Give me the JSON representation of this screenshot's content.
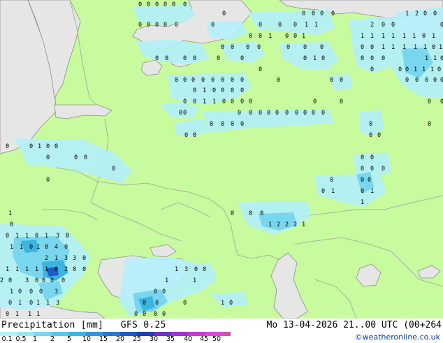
{
  "product_label": "Precipitation [mm]",
  "model_label": "GFS 0.25",
  "valid_time": "Mo 13-04-2026 21..00 UTC (00+264",
  "credit": "©weatheronline.co.uk",
  "scale_ticks": [
    "0.1",
    "0.5",
    "1",
    "2",
    "5",
    "10",
    "15",
    "20",
    "25",
    "30",
    "35",
    "40",
    "45",
    "50"
  ],
  "scale_colors": [
    "#b4f0fa",
    "#96e6f5",
    "#78d7ee",
    "#5ac8e6",
    "#3cb4e1",
    "#3296dc",
    "#2878d2",
    "#1e5ac8",
    "#1e3cb4",
    "#6e32c8",
    "#a032d2",
    "#c83ccf",
    "#dc46dc",
    "#d250aa"
  ],
  "colors": {
    "land": "#c8fa9e",
    "sea": "#e6e6e6",
    "border": "#a0a0a0",
    "coast": "#8c8c8c"
  },
  "value_labels": [
    "0",
    "0",
    "0",
    "0",
    "0",
    "0",
    "0",
    "0",
    "0",
    "0",
    "0",
    "1",
    "2",
    "0",
    "0",
    "0",
    "0",
    "0",
    "0",
    "0",
    "0",
    "0",
    "0",
    "0",
    "1",
    "1",
    "1",
    "2",
    "0",
    "0",
    "0",
    "0",
    "1",
    "0",
    "0",
    "1",
    "0",
    "1",
    "1",
    "1",
    "1",
    "1",
    "0",
    "1",
    "0",
    "0",
    "0",
    "0",
    "0",
    "0",
    "0",
    "0",
    "0",
    "1",
    "1",
    "1",
    "1",
    "1",
    "0",
    "1",
    "0",
    "0",
    "0",
    "0",
    "0",
    "0",
    "0",
    "0",
    "1",
    "0",
    "1",
    "1",
    "0",
    "0",
    "0",
    "0",
    "0",
    "0",
    "0",
    "0",
    "1",
    "1",
    "1",
    "0",
    "0",
    "0",
    "0",
    "0",
    "0",
    "0",
    "0",
    "0",
    "0",
    "0",
    "0",
    "0",
    "0",
    "0",
    "0",
    "0",
    "0",
    "0",
    "1",
    "0",
    "0",
    "0",
    "0",
    "0",
    "0",
    "1",
    "1",
    "0",
    "0",
    "0",
    "0",
    "0",
    "0",
    "0",
    "0",
    "0",
    "0",
    "0",
    "0",
    "0",
    "0",
    "0",
    "0",
    "0",
    "0",
    "0",
    "0",
    "0",
    "0",
    "0",
    "0",
    "0",
    "0",
    "0",
    "0",
    "0",
    "0",
    "1",
    "0",
    "0",
    "0",
    "0",
    "0",
    "0",
    "0",
    "0",
    "0",
    "0",
    "0",
    "0",
    "0",
    "0",
    "0",
    "0",
    "1",
    "0",
    "1",
    "1",
    "1",
    "0",
    "0",
    "0",
    "1",
    "2",
    "2",
    "2",
    "1",
    "0",
    "0",
    "1",
    "1",
    "0",
    "1",
    "3",
    "0",
    "1",
    "1",
    "0",
    "1",
    "0",
    "4",
    "0",
    "2",
    "1",
    "3",
    "3",
    "0",
    "1",
    "1",
    "1",
    "1",
    "1",
    "0",
    "2",
    "0",
    "0",
    "1",
    "3",
    "0",
    "0",
    "2",
    "0",
    "3",
    "0",
    "0",
    "0",
    "0",
    "1",
    "1",
    "1",
    "0",
    "0",
    "0",
    "3",
    "0",
    "0",
    "0",
    "1",
    "0",
    "1",
    "1",
    "3",
    "0",
    "0",
    "0",
    "1",
    "0",
    "0",
    "1",
    "1",
    "1",
    "0",
    "0",
    "0",
    "0"
  ]
}
